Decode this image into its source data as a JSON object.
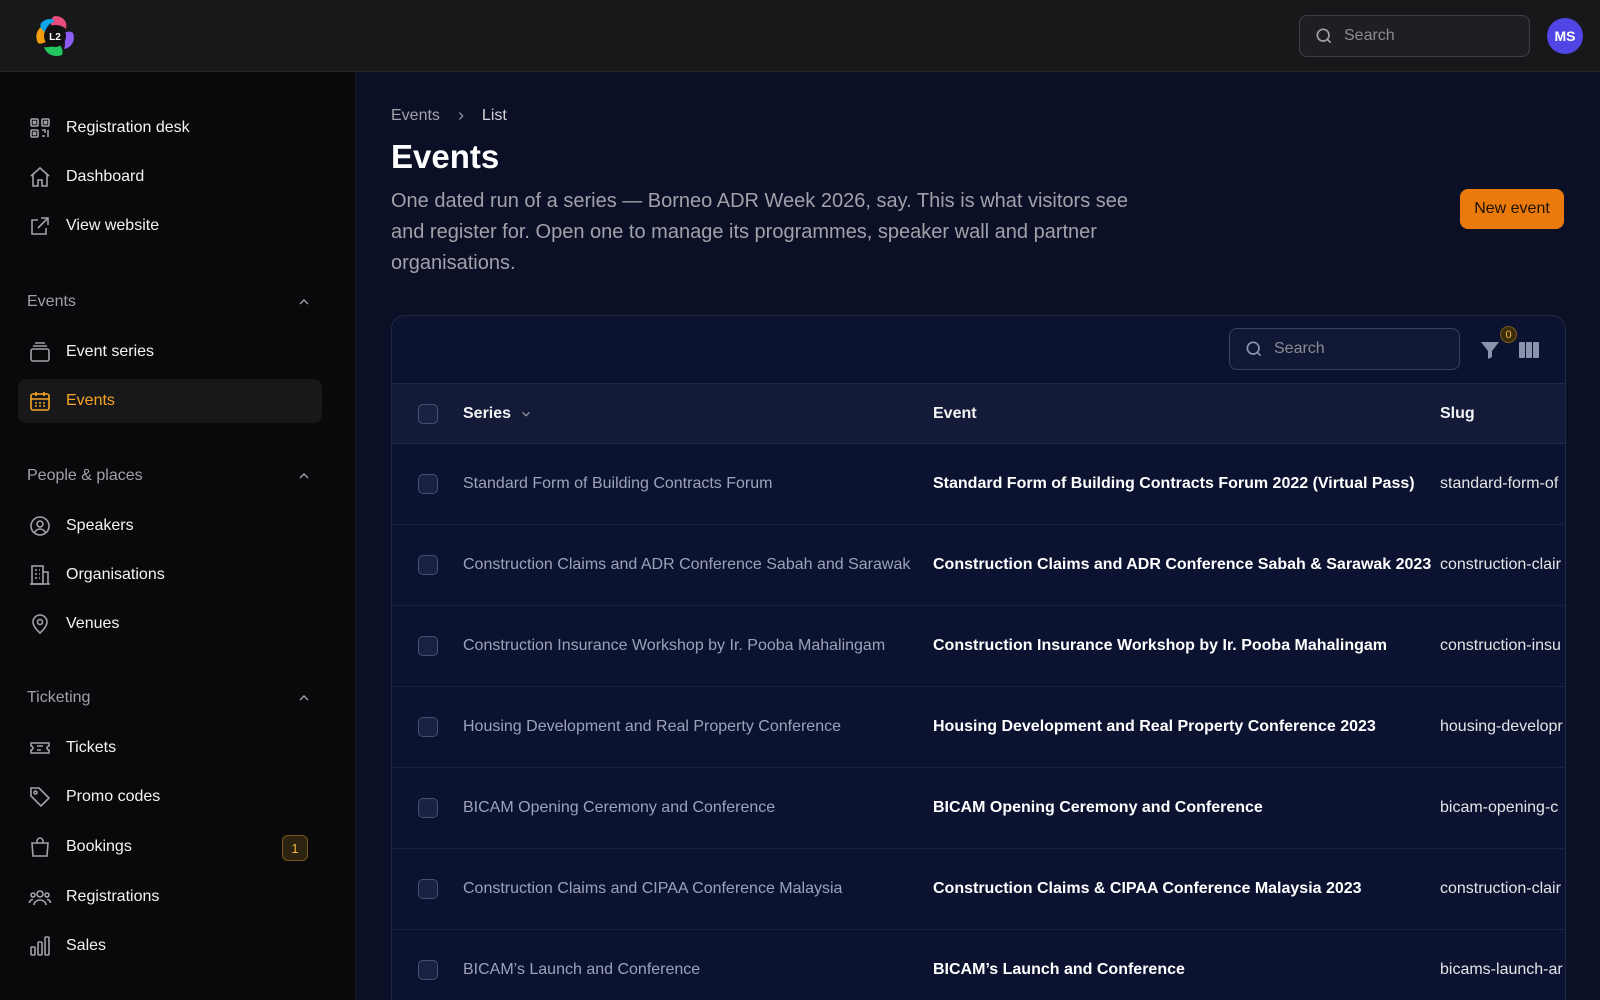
{
  "header": {
    "logo_text": "L2",
    "search_placeholder": "Search",
    "avatar_initials": "MS"
  },
  "sidebar": {
    "top_items": [
      {
        "label": "Registration desk",
        "icon": "qr-code-icon"
      },
      {
        "label": "Dashboard",
        "icon": "home-icon"
      },
      {
        "label": "View website",
        "icon": "external-link-icon"
      }
    ],
    "groups": [
      {
        "label": "Events",
        "items": [
          {
            "label": "Event series",
            "icon": "stack-icon"
          },
          {
            "label": "Events",
            "icon": "calendar-icon",
            "active": true
          }
        ]
      },
      {
        "label": "People & places",
        "items": [
          {
            "label": "Speakers",
            "icon": "user-circle-icon"
          },
          {
            "label": "Organisations",
            "icon": "building-icon"
          },
          {
            "label": "Venues",
            "icon": "map-pin-icon"
          }
        ]
      },
      {
        "label": "Ticketing",
        "items": [
          {
            "label": "Tickets",
            "icon": "ticket-icon"
          },
          {
            "label": "Promo codes",
            "icon": "tag-icon"
          },
          {
            "label": "Bookings",
            "icon": "shopping-bag-icon",
            "badge": "1"
          },
          {
            "label": "Registrations",
            "icon": "users-icon"
          },
          {
            "label": "Sales",
            "icon": "bar-chart-icon"
          }
        ]
      }
    ]
  },
  "main": {
    "breadcrumb": [
      "Events",
      "List"
    ],
    "title": "Events",
    "description": "One dated run of a series — Borneo ADR Week 2026, say. This is what visitors see and register for. Open one to manage its programmes, speaker wall and partner organisations.",
    "new_button": "New event",
    "table": {
      "search_placeholder": "Search",
      "filter_count": "0",
      "columns": {
        "series": "Series",
        "event": "Event",
        "slug": "Slug"
      },
      "rows": [
        {
          "series": "Standard Form of Building Contracts Forum",
          "event": "Standard Form of Building Contracts Forum 2022 (Virtual Pass)",
          "slug": "standard-form-of"
        },
        {
          "series": "Construction Claims and ADR Conference Sabah and Sarawak",
          "event": "Construction Claims and ADR Conference Sabah & Sarawak 2023",
          "slug": "construction-clair"
        },
        {
          "series": "Construction Insurance Workshop by Ir. Pooba Mahalingam",
          "event": "Construction Insurance Workshop by Ir. Pooba Mahalingam",
          "slug": "construction-insu"
        },
        {
          "series": "Housing Development and Real Property Conference",
          "event": "Housing Development and Real Property Conference 2023",
          "slug": "housing-developr"
        },
        {
          "series": "BICAM Opening Ceremony and Conference",
          "event": "BICAM Opening Ceremony and Conference",
          "slug": "bicam-opening-c"
        },
        {
          "series": "Construction Claims and CIPAA Conference Malaysia",
          "event": "Construction Claims & CIPAA Conference Malaysia 2023",
          "slug": "construction-clair"
        },
        {
          "series": "BICAM’s Launch and Conference",
          "event": "BICAM’s Launch and Conference",
          "slug": "bicams-launch-ar"
        }
      ]
    }
  },
  "colors": {
    "accent": "#f5a524",
    "primary_button": "#ea7a0b",
    "avatar": "#5046e5",
    "page_bg": "#0b1026",
    "sidebar_bg": "#09090b"
  }
}
